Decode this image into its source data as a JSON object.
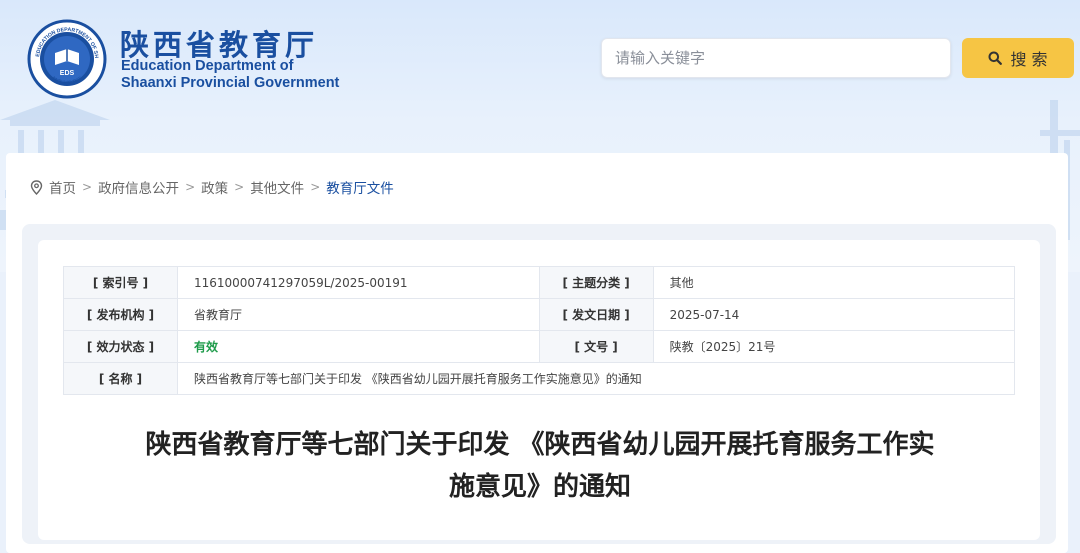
{
  "header": {
    "title_cn": "陕西省教育厅",
    "title_en_line1": "Education Department of",
    "title_en_line2": "Shaanxi Provincial Government",
    "emblem_ring_text": "EDUCATION DEPARTMENT OF SHAANXI",
    "emblem_center": "EDS",
    "emblem_bottom": "陕西省教育厅"
  },
  "search": {
    "placeholder": "请输入关键字",
    "button_label": "搜 索"
  },
  "breadcrumb": {
    "items": [
      "首页",
      "政府信息公开",
      "政策",
      "其他文件",
      "教育厅文件"
    ],
    "separator": ">"
  },
  "meta": {
    "index_label": "[ 索引号 ]",
    "index_value": "11610000741297059L/2025-00191",
    "topic_label": "[ 主题分类 ]",
    "topic_value": "其他",
    "publisher_label": "[ 发布机构 ]",
    "publisher_value": "省教育厅",
    "date_label": "[ 发文日期 ]",
    "date_value": "2025-07-14",
    "status_label": "[ 效力状态 ]",
    "status_value": "有效",
    "docno_label": "[ 文号 ]",
    "docno_value": "陕教〔2025〕21号",
    "name_label": "[ 名称 ]",
    "name_value": "陕西省教育厅等七部门关于印发 《陕西省幼儿园开展托育服务工作实施意见》的通知"
  },
  "article": {
    "title_line1": "陕西省教育厅等七部门关于印发 《陕西省幼儿园开展托育服务工作实",
    "title_line2": "施意见》的通知"
  },
  "colors": {
    "brand_blue": "#1a4fa0",
    "search_button": "#f6c544",
    "valid_green": "#1e9b4a"
  }
}
